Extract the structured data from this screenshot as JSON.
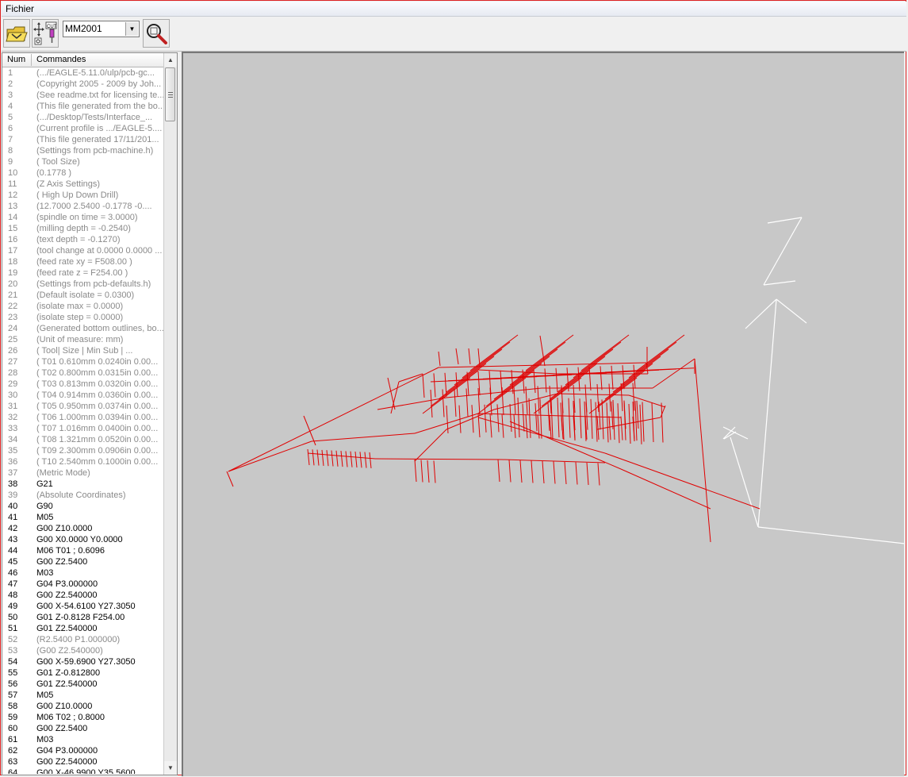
{
  "menu": {
    "file_label": "Fichier"
  },
  "toolbar": {
    "open_icon": "folder-open-icon",
    "tool_icon": "cut-tool-icon",
    "machine_select_value": "MM2001",
    "zoom_icon": "magnifier-zoom-icon"
  },
  "list": {
    "headers": {
      "num": "Num",
      "cmd": "Commandes"
    },
    "rows": [
      {
        "num": "1",
        "cmd": "(.../EAGLE-5.11.0/ulp/pcb-gc...",
        "comment": true
      },
      {
        "num": "2",
        "cmd": "(Copyright 2005 - 2009 by Joh...",
        "comment": true
      },
      {
        "num": "3",
        "cmd": "(See readme.txt for licensing te...",
        "comment": true
      },
      {
        "num": "4",
        "cmd": "(This file generated from the bo...",
        "comment": true
      },
      {
        "num": "5",
        "cmd": "(.../Desktop/Tests/Interface_...",
        "comment": true
      },
      {
        "num": "6",
        "cmd": "(Current profile is .../EAGLE-5....",
        "comment": true
      },
      {
        "num": "7",
        "cmd": "(This file generated 17/11/201...",
        "comment": true
      },
      {
        "num": "8",
        "cmd": "(Settings from pcb-machine.h)",
        "comment": true
      },
      {
        "num": "9",
        "cmd": "(  Tool Size)",
        "comment": true
      },
      {
        "num": "10",
        "cmd": "(0.1778 )",
        "comment": true
      },
      {
        "num": "11",
        "cmd": "(Z Axis Settings)",
        "comment": true
      },
      {
        "num": "12",
        "cmd": "(  High     Up        Down     Drill)",
        "comment": true
      },
      {
        "num": "13",
        "cmd": "(12.7000 2.5400 -0.1778 -0....",
        "comment": true
      },
      {
        "num": "14",
        "cmd": "(spindle on time = 3.0000)",
        "comment": true
      },
      {
        "num": "15",
        "cmd": "(milling depth = -0.2540)",
        "comment": true
      },
      {
        "num": "16",
        "cmd": "(text depth = -0.1270)",
        "comment": true
      },
      {
        "num": "17",
        "cmd": "(tool change at 0.0000 0.0000 ...",
        "comment": true
      },
      {
        "num": "18",
        "cmd": "(feed rate xy = F508.00 )",
        "comment": true
      },
      {
        "num": "19",
        "cmd": "(feed rate z  = F254.00 )",
        "comment": true
      },
      {
        "num": "20",
        "cmd": "(Settings from pcb-defaults.h)",
        "comment": true
      },
      {
        "num": "21",
        "cmd": "(Default isolate = 0.0300)",
        "comment": true
      },
      {
        "num": "22",
        "cmd": "(isolate max = 0.0000)",
        "comment": true
      },
      {
        "num": "23",
        "cmd": "(isolate step = 0.0000)",
        "comment": true
      },
      {
        "num": "24",
        "cmd": "(Generated bottom outlines, bo...",
        "comment": true
      },
      {
        "num": "25",
        "cmd": "(Unit of measure: mm)",
        "comment": true
      },
      {
        "num": "26",
        "cmd": "( Tool|       Size       |  Min Sub | ...",
        "comment": true
      },
      {
        "num": "27",
        "cmd": "( T01  0.610mm 0.0240in 0.00...",
        "comment": true
      },
      {
        "num": "28",
        "cmd": "( T02  0.800mm 0.0315in 0.00...",
        "comment": true
      },
      {
        "num": "29",
        "cmd": "( T03  0.813mm 0.0320in 0.00...",
        "comment": true
      },
      {
        "num": "30",
        "cmd": "( T04  0.914mm 0.0360in 0.00...",
        "comment": true
      },
      {
        "num": "31",
        "cmd": "( T05  0.950mm 0.0374in 0.00...",
        "comment": true
      },
      {
        "num": "32",
        "cmd": "( T06  1.000mm 0.0394in 0.00...",
        "comment": true
      },
      {
        "num": "33",
        "cmd": "( T07  1.016mm 0.0400in 0.00...",
        "comment": true
      },
      {
        "num": "34",
        "cmd": "( T08  1.321mm 0.0520in 0.00...",
        "comment": true
      },
      {
        "num": "35",
        "cmd": "( T09  2.300mm 0.0906in 0.00...",
        "comment": true
      },
      {
        "num": "36",
        "cmd": "( T10  2.540mm 0.1000in 0.00...",
        "comment": true
      },
      {
        "num": "37",
        "cmd": "(Metric Mode)",
        "comment": true
      },
      {
        "num": "38",
        "cmd": "G21",
        "comment": false
      },
      {
        "num": "39",
        "cmd": "(Absolute Coordinates)",
        "comment": true
      },
      {
        "num": "40",
        "cmd": "G90",
        "comment": false
      },
      {
        "num": "41",
        "cmd": "M05",
        "comment": false
      },
      {
        "num": "42",
        "cmd": "G00 Z10.0000",
        "comment": false
      },
      {
        "num": "43",
        "cmd": "G00 X0.0000 Y0.0000",
        "comment": false
      },
      {
        "num": "44",
        "cmd": "M06 T01   ; 0.6096",
        "comment": false
      },
      {
        "num": "45",
        "cmd": "G00 Z2.5400",
        "comment": false
      },
      {
        "num": "46",
        "cmd": "M03",
        "comment": false
      },
      {
        "num": "47",
        "cmd": "G04 P3.000000",
        "comment": false
      },
      {
        "num": "48",
        "cmd": "G00 Z2.540000",
        "comment": false
      },
      {
        "num": "49",
        "cmd": "G00 X-54.6100 Y27.3050",
        "comment": false
      },
      {
        "num": "50",
        "cmd": "G01 Z-0.8128 F254.00",
        "comment": false
      },
      {
        "num": "51",
        "cmd": "G01 Z2.540000",
        "comment": false
      },
      {
        "num": "52",
        "cmd": "(R2.5400  P1.000000)",
        "comment": true
      },
      {
        "num": "53",
        "cmd": "(G00 Z2.540000)",
        "comment": true
      },
      {
        "num": "54",
        "cmd": "G00 X-59.6900 Y27.3050",
        "comment": false
      },
      {
        "num": "55",
        "cmd": "G01 Z-0.812800",
        "comment": false
      },
      {
        "num": "56",
        "cmd": "G01 Z2.540000",
        "comment": false
      },
      {
        "num": "57",
        "cmd": "M05",
        "comment": false
      },
      {
        "num": "58",
        "cmd": "G00 Z10.0000",
        "comment": false
      },
      {
        "num": "59",
        "cmd": "M06 T02   ; 0.8000",
        "comment": false
      },
      {
        "num": "60",
        "cmd": "G00 Z2.5400",
        "comment": false
      },
      {
        "num": "61",
        "cmd": "M03",
        "comment": false
      },
      {
        "num": "62",
        "cmd": "G04 P3.000000",
        "comment": false
      },
      {
        "num": "63",
        "cmd": "G00 Z2.540000",
        "comment": false
      },
      {
        "num": "64",
        "cmd": "G00 X-46.9900 Y35.5600",
        "comment": false
      }
    ]
  },
  "viewport": {
    "toolpath_color": "#e00000",
    "axis_color": "#ffffff",
    "background_color": "#c8c8c8",
    "axis_label": "Z"
  }
}
